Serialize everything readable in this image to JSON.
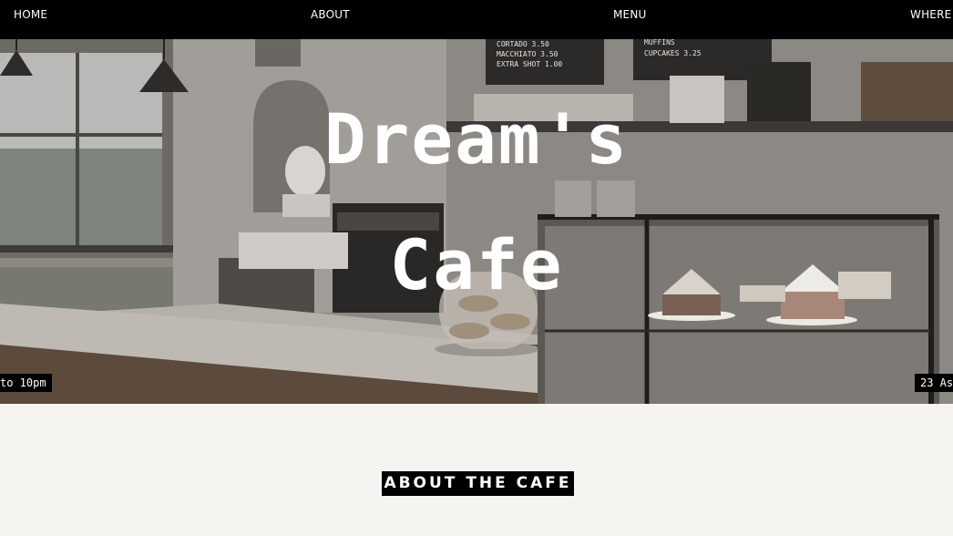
{
  "nav": {
    "home": "HOME",
    "about": "ABOUT",
    "menu": "MENU",
    "where": "WHERE"
  },
  "hero": {
    "title_line1": "Dream's",
    "title_line2": "Cafe",
    "ticker_left": "to 10pm",
    "ticker_right": "23 As",
    "board_left": [
      "CORTADO 3.50",
      "MACCHIATO 3.50",
      "EXTRA SHOT 1.00"
    ],
    "board_right": [
      "MUFFINS",
      "CUPCAKES 3.25"
    ]
  },
  "about": {
    "heading": "ABOUT THE CAFE"
  },
  "colors": {
    "nav_bg": "#000000",
    "page_bg": "#f5f4f1",
    "text_light": "#ffffff"
  }
}
